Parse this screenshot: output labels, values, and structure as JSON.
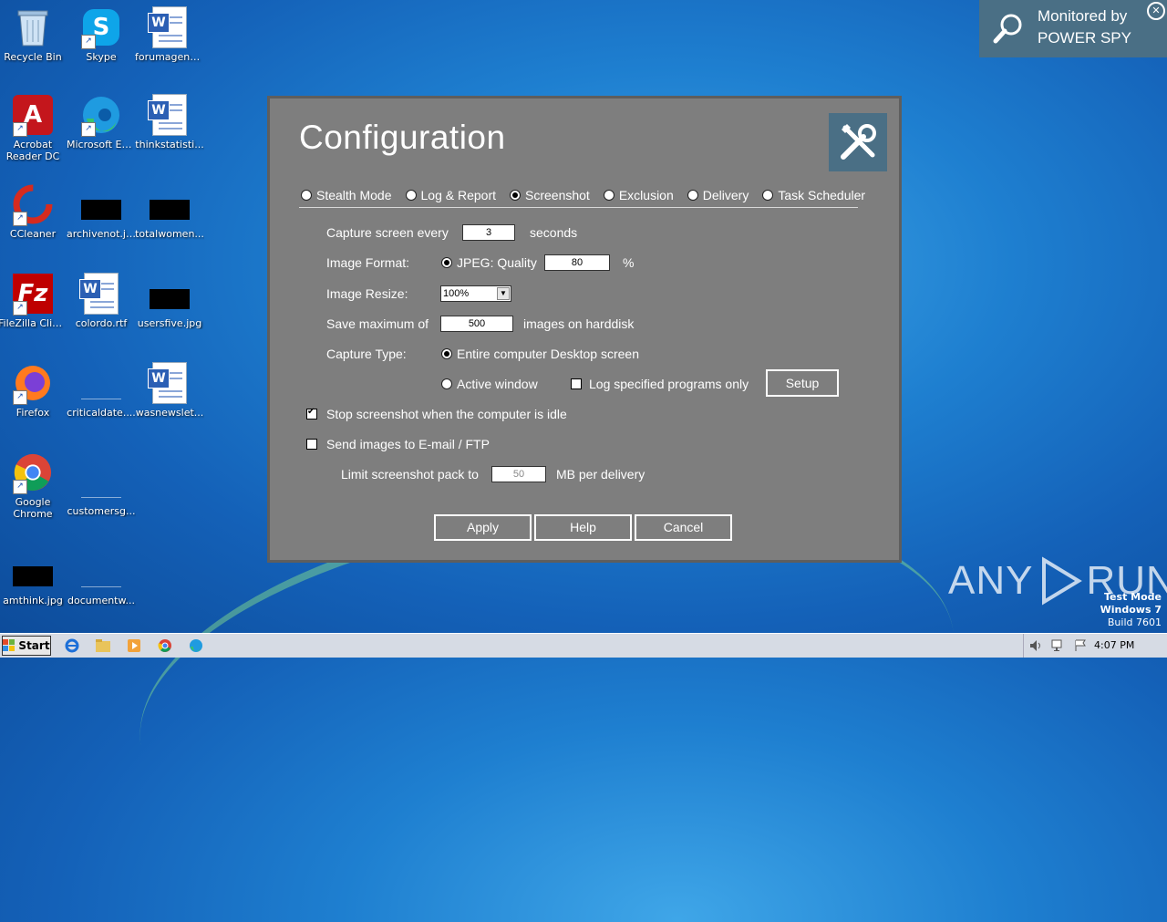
{
  "desktop": {
    "icons": [
      {
        "label": "Recycle Bin"
      },
      {
        "label": "Skype"
      },
      {
        "label": "forumagenc..."
      },
      {
        "label": "Acrobat Reader DC"
      },
      {
        "label": "Microsoft Edge"
      },
      {
        "label": "thinkstatisti..."
      },
      {
        "label": "CCleaner"
      },
      {
        "label": "archivenot.jpg"
      },
      {
        "label": "totalwomen..."
      },
      {
        "label": "FileZilla Client"
      },
      {
        "label": "colordo.rtf"
      },
      {
        "label": "usersfive.jpg"
      },
      {
        "label": "Firefox"
      },
      {
        "label": "criticaldate...."
      },
      {
        "label": "wasnewslet..."
      },
      {
        "label": "Google Chrome"
      },
      {
        "label": "customersg..."
      },
      {
        "label": "amthink.jpg"
      },
      {
        "label": "documentw..."
      }
    ]
  },
  "monitor_banner": {
    "line1": "Monitored by",
    "line2": "POWER SPY",
    "close_glyph": "✕"
  },
  "dialog": {
    "title": "Configuration",
    "tabs": [
      {
        "label": "Stealth Mode",
        "selected": false
      },
      {
        "label": "Log & Report",
        "selected": false
      },
      {
        "label": "Screenshot",
        "selected": true
      },
      {
        "label": "Exclusion",
        "selected": false
      },
      {
        "label": "Delivery",
        "selected": false
      },
      {
        "label": "Task Scheduler",
        "selected": false
      }
    ],
    "capture_every": {
      "label": "Capture screen every",
      "value": "3",
      "unit": "seconds"
    },
    "image_format": {
      "label": "Image Format:",
      "option": "JPEG: Quality",
      "value": "80",
      "unit": "%"
    },
    "image_resize": {
      "label": "Image Resize:",
      "value": "100%"
    },
    "save_max": {
      "label": "Save maximum of",
      "value": "500",
      "unit": "images on harddisk"
    },
    "capture_type": {
      "label": "Capture Type:",
      "option1": "Entire computer Desktop screen",
      "option2": "Active window",
      "log_programs": "Log specified programs only",
      "setup_label": "Setup"
    },
    "stop_idle": {
      "label": "Stop screenshot when the computer is idle",
      "checked": true
    },
    "send_images": {
      "label": "Send images to E-mail / FTP",
      "checked": false
    },
    "limit": {
      "label": "Limit screenshot pack to",
      "value": "50",
      "unit": "MB per delivery"
    },
    "buttons": {
      "apply": "Apply",
      "help": "Help",
      "cancel": "Cancel"
    }
  },
  "watermark": {
    "text_left": "ANY",
    "text_right": "RUN"
  },
  "test_mode": {
    "line1": "Test Mode",
    "line2": "Windows 7",
    "line3": "Build 7601"
  },
  "taskbar": {
    "start_label": "Start",
    "clock": "4:07 PM"
  }
}
